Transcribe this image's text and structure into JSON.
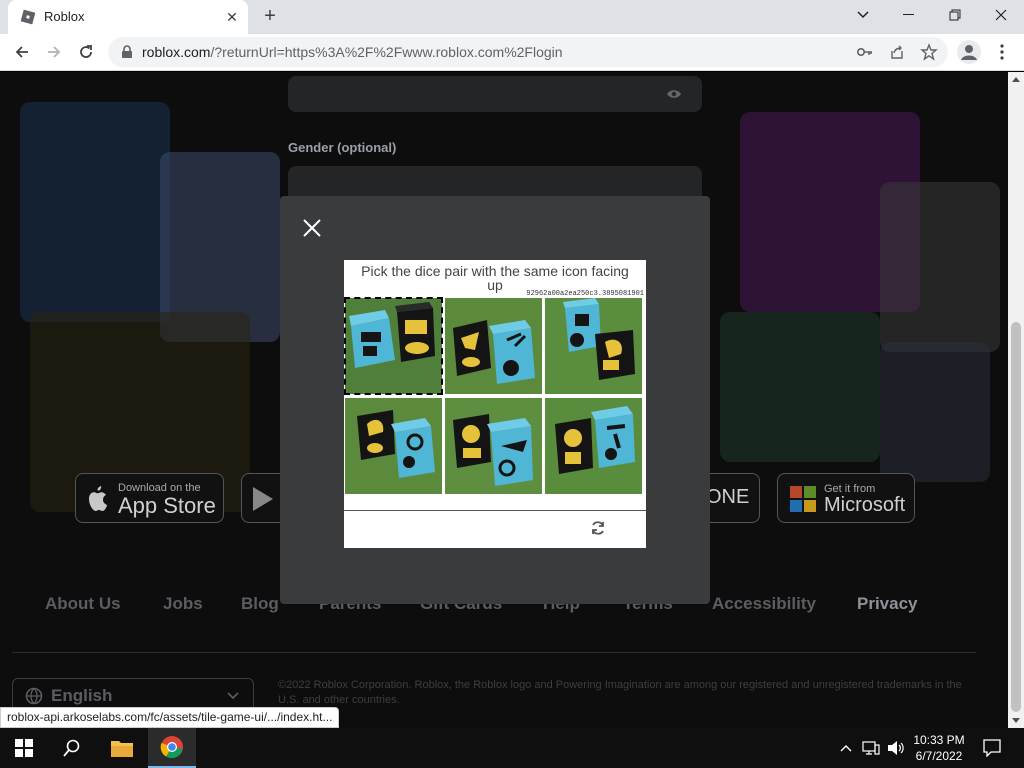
{
  "browser": {
    "tab_title": "Roblox",
    "url_host": "roblox.com",
    "url_path": "/?returnUrl=https%3A%2F%2Fwww.roblox.com%2Flogin",
    "status_url": "roblox-api.arkoselabs.com/fc/assets/tile-game-ui/.../index.ht..."
  },
  "signup_form": {
    "gender_label": "Gender (optional)"
  },
  "captcha": {
    "prompt": "Pick the dice pair with the same icon facing up",
    "session_id": "92962a00a2ea250c3.3895081901",
    "tiles": [
      {
        "name": "tile-1",
        "selected": true
      },
      {
        "name": "tile-2",
        "selected": false
      },
      {
        "name": "tile-3",
        "selected": false
      },
      {
        "name": "tile-4",
        "selected": false
      },
      {
        "name": "tile-5",
        "selected": false
      },
      {
        "name": "tile-6",
        "selected": false
      }
    ]
  },
  "store_badges": {
    "app_store_small": "Download on the",
    "app_store_big": "App Store",
    "xbox_text": "ONE",
    "microsoft_small": "Get it from",
    "microsoft_big": "Microsoft"
  },
  "footer": {
    "links": [
      "About Us",
      "Jobs",
      "Blog",
      "Parents",
      "Gift Cards",
      "Help",
      "Terms",
      "Accessibility",
      "Privacy"
    ],
    "language": "English",
    "copyright": "©2022 Roblox Corporation. Roblox, the Roblox logo and Powering Imagination are among our registered and unregistered trademarks in the U.S. and other countries."
  },
  "taskbar": {
    "time": "10:33 PM",
    "date": "6/7/2022"
  },
  "colors": {
    "page_bg": "#0d0d0e",
    "modal_bg": "#393b3d",
    "tile_green": "#5b8a3c",
    "dice_blue": "#4fb6d6",
    "dice_black": "#141414",
    "icon_yellow": "#e6c23a"
  }
}
